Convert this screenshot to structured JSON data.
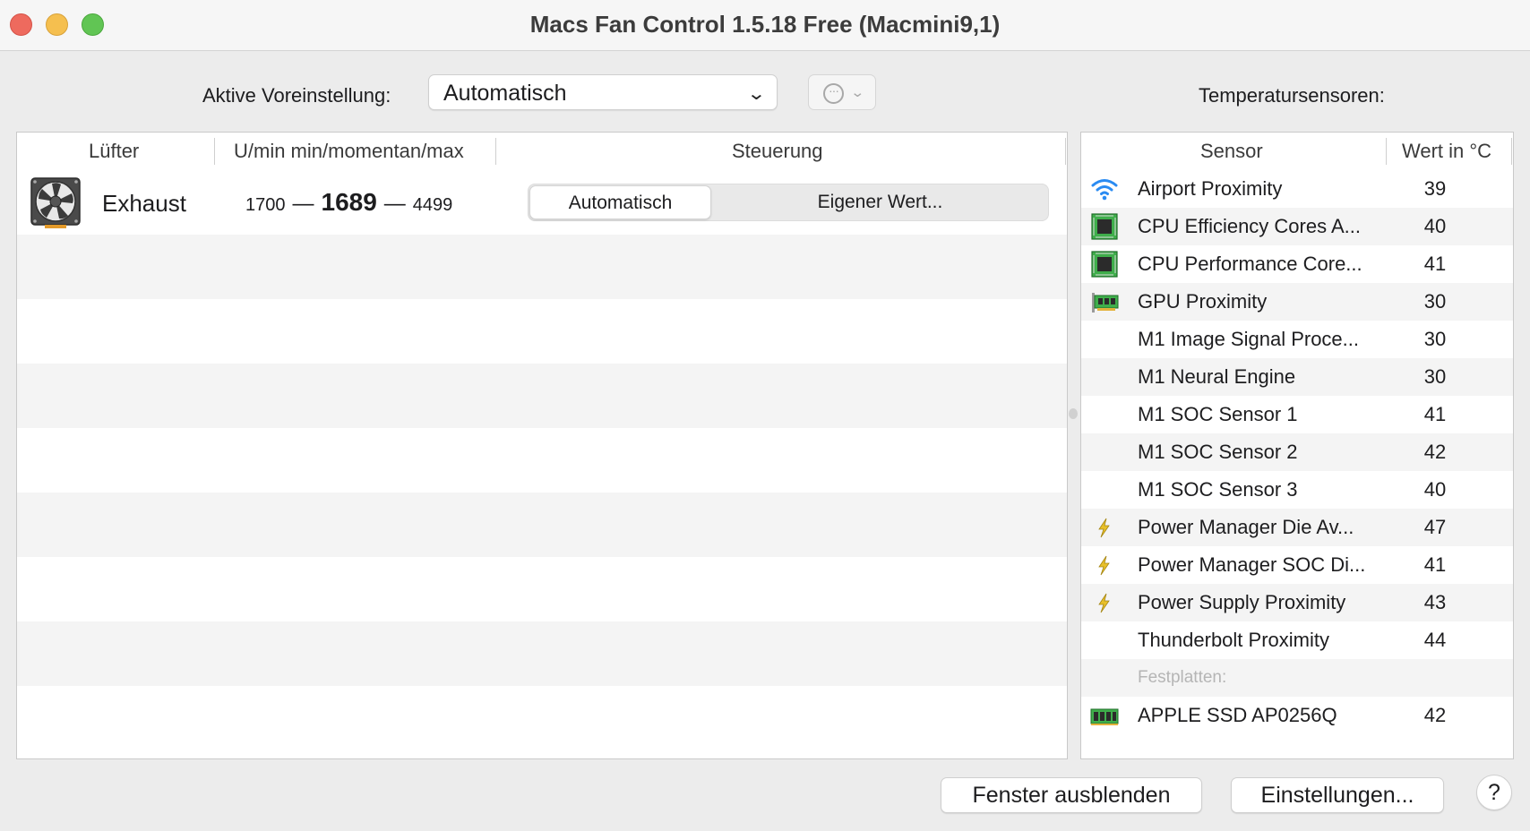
{
  "window": {
    "title": "Macs Fan Control 1.5.18 Free (Macmini9,1)"
  },
  "toolbar": {
    "preset_label": "Aktive Voreinstellung:",
    "preset_value": "Automatisch",
    "sensors_label": "Temperatursensoren:"
  },
  "fans": {
    "headers": {
      "fan": "Lüfter",
      "rpm": "U/min min/momentan/max",
      "control": "Steuerung"
    },
    "rows": [
      {
        "name": "Exhaust",
        "rpm_min": "1700",
        "rpm_current": "1689",
        "rpm_max": "4499",
        "control_auto": "Automatisch",
        "control_custom": "Eigener Wert..."
      }
    ],
    "dash": "—"
  },
  "sensors": {
    "headers": {
      "sensor": "Sensor",
      "value": "Wert in °C"
    },
    "rows": [
      {
        "name": "Airport Proximity",
        "value": "39",
        "icon": "wifi-icon"
      },
      {
        "name": "CPU Efficiency Cores A...",
        "value": "40",
        "icon": "chip-icon"
      },
      {
        "name": "CPU Performance Core...",
        "value": "41",
        "icon": "chip-icon"
      },
      {
        "name": "GPU Proximity",
        "value": "30",
        "icon": "gpu-card-icon"
      },
      {
        "name": "M1 Image Signal Proce...",
        "value": "30",
        "icon": ""
      },
      {
        "name": "M1 Neural Engine",
        "value": "30",
        "icon": ""
      },
      {
        "name": "M1 SOC Sensor 1",
        "value": "41",
        "icon": ""
      },
      {
        "name": "M1 SOC Sensor 2",
        "value": "42",
        "icon": ""
      },
      {
        "name": "M1 SOC Sensor 3",
        "value": "40",
        "icon": ""
      },
      {
        "name": "Power Manager Die Av...",
        "value": "47",
        "icon": "lightning-icon"
      },
      {
        "name": "Power Manager SOC Di...",
        "value": "41",
        "icon": "lightning-icon"
      },
      {
        "name": "Power Supply Proximity",
        "value": "43",
        "icon": "lightning-icon"
      },
      {
        "name": "Thunderbolt Proximity",
        "value": "44",
        "icon": ""
      }
    ],
    "section_label": "Festplatten:",
    "disks": [
      {
        "name": "APPLE SSD AP0256Q",
        "value": "42",
        "icon": "ssd-icon"
      }
    ]
  },
  "footer": {
    "hide_window": "Fenster ausblenden",
    "settings": "Einstellungen...",
    "help": "?"
  },
  "colors": {
    "close": "#ee6a5e",
    "minimize": "#f5bf4f",
    "maximize": "#61c554",
    "wifi": "#2a8bf2",
    "chip": "#3fae4b",
    "lightning": "#e8c02a"
  }
}
